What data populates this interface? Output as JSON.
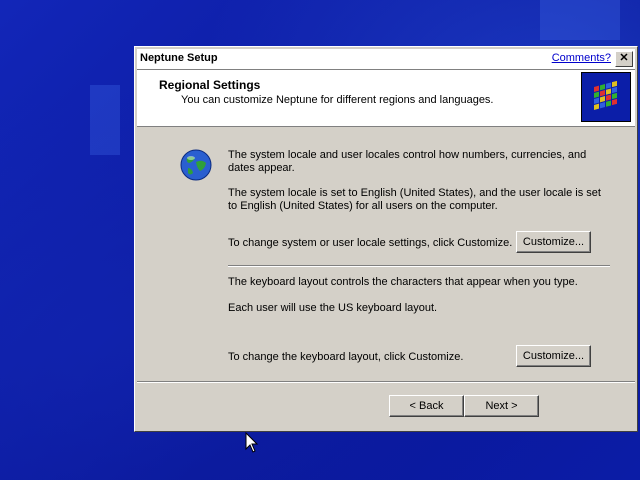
{
  "window": {
    "title": "Neptune Setup",
    "comments_link": "Comments?",
    "close_glyph": "✕"
  },
  "header": {
    "title": "Regional Settings",
    "subtitle": "You can customize Neptune for different regions and languages."
  },
  "locale": {
    "description": "The system locale and user locales control how numbers, currencies, and dates appear.",
    "current": "The system locale is set to English (United States), and the user locale is set to English (United States) for all users on the computer.",
    "change_prompt": "To change system or user locale settings, click Customize.",
    "customize_label": "Customize..."
  },
  "keyboard": {
    "description": "The keyboard layout controls the characters that appear when you type.",
    "current": "Each user will use the US keyboard layout.",
    "change_prompt": "To change the keyboard layout, click Customize.",
    "customize_label": "Customize..."
  },
  "nav": {
    "back_label": "< Back",
    "next_label": "Next >"
  },
  "icons": {
    "globe": "globe-icon",
    "setup_logo": "windows-logo-icon",
    "cursor": "mouse-pointer-icon"
  }
}
